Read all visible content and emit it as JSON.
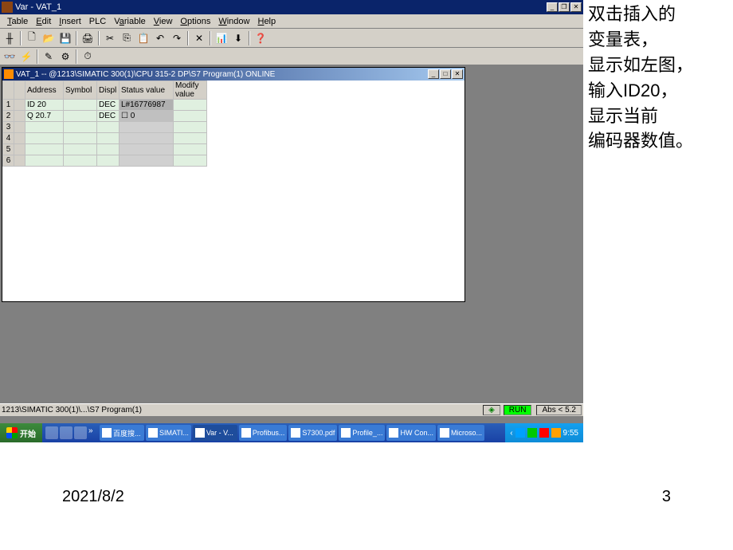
{
  "titlebar": {
    "text": "Var - VAT_1"
  },
  "menu": {
    "table": "Table",
    "edit": "Edit",
    "insert": "Insert",
    "plc": "PLC",
    "variable": "Variable",
    "view": "View",
    "options": "Options",
    "window": "Window",
    "help": "Help"
  },
  "toolbar1_icons": [
    "sep-icon",
    "new-icon",
    "open-icon",
    "save-icon",
    "print-icon",
    "sep",
    "cut-icon",
    "copy-icon",
    "paste-icon",
    "undo-icon",
    "redo-icon",
    "sep",
    "delete-icon",
    "sep",
    "monitor-icon",
    "download-icon",
    "sep",
    "help-icon"
  ],
  "toolbar2_icons": [
    "glasses-icon",
    "monitor-var-icon",
    "modify-icon",
    "force-icon",
    "trigger-icon"
  ],
  "vat_window": {
    "title": "VAT_1 -- @1213\\SIMATIC 300(1)\\CPU 315-2 DP\\S7 Program(1)  ONLINE",
    "columns": [
      "",
      "Address",
      "Symbol",
      "Displ",
      "Status value",
      "Modify value"
    ],
    "rows": [
      {
        "n": "1",
        "addr": "ID   20",
        "sym": "",
        "disp": "DEC",
        "status": "L#16776987",
        "modify": ""
      },
      {
        "n": "2",
        "addr": "Q    20.7",
        "sym": "",
        "disp": "DEC",
        "status": "0",
        "modify": ""
      },
      {
        "n": "3",
        "addr": "",
        "sym": "",
        "disp": "",
        "status": "",
        "modify": ""
      },
      {
        "n": "4",
        "addr": "",
        "sym": "",
        "disp": "",
        "status": "",
        "modify": ""
      },
      {
        "n": "5",
        "addr": "",
        "sym": "",
        "disp": "",
        "status": "",
        "modify": ""
      },
      {
        "n": "6",
        "addr": "",
        "sym": "",
        "disp": "",
        "status": "",
        "modify": ""
      }
    ]
  },
  "statusbar": {
    "path": "1213\\SIMATIC 300(1)\\...\\S7 Program(1)",
    "run": "RUN",
    "abs": "Abs < 5.2"
  },
  "taskbar": {
    "start": "开始",
    "tasks": [
      {
        "label": "百度搜..."
      },
      {
        "label": "SIMATI..."
      },
      {
        "label": "Var - V...",
        "active": true
      },
      {
        "label": "Profibus..."
      },
      {
        "label": "S7300.pdf"
      },
      {
        "label": "Profile_..."
      },
      {
        "label": "HW Con..."
      },
      {
        "label": "Microso..."
      }
    ],
    "time": "9:55"
  },
  "annotation": {
    "line1": "双击插入的",
    "line2": "变量表，",
    "line3": "显示如左图，",
    "line4": "输入ID20，",
    "line5": "显示当前",
    "line6": "编码器数值。"
  },
  "footer": {
    "date": "2021/8/2",
    "page": "3"
  }
}
